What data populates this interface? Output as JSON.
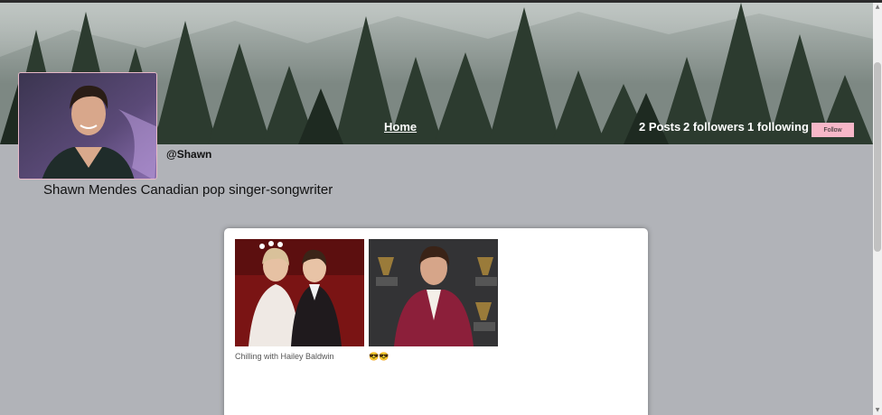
{
  "nav": {
    "home_label": "Home"
  },
  "profile": {
    "username": "@Shawn",
    "bio": "Shawn Mendes Canadian pop singer-songwriter",
    "stats": {
      "posts": "2 Posts",
      "followers": "2 followers",
      "following": "1 following"
    },
    "follow_label": "Follow"
  },
  "posts": [
    {
      "caption": "Chilling with Hailey Baldwin"
    },
    {
      "caption": "😎😎"
    }
  ],
  "colors": {
    "page_background": "#b1b3b8",
    "follow_button": "#f7b7c8",
    "card_background": "#ffffff"
  }
}
